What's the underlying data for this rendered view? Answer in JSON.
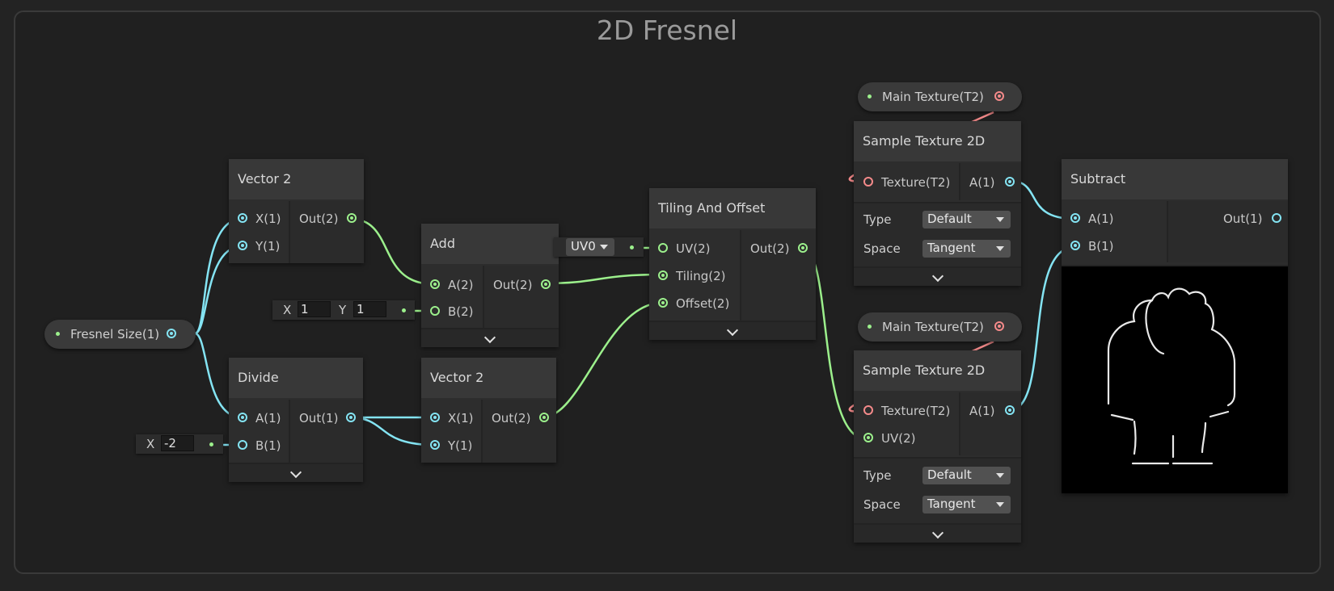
{
  "graph_title": "2D Fresnel",
  "colors": {
    "vector": "#84e4f3",
    "vector2": "#9cf08c",
    "texture": "#f48a8a"
  },
  "properties": {
    "fresnel_size": "Fresnel Size(1)",
    "main_texture_1": "Main Texture(T2)",
    "main_texture_2": "Main Texture(T2)"
  },
  "nodes": {
    "vector2_top": {
      "title": "Vector 2",
      "in_x": "X(1)",
      "in_y": "Y(1)",
      "out": "Out(2)"
    },
    "add": {
      "title": "Add",
      "in_a": "A(2)",
      "in_b": "B(2)",
      "out": "Out(2)",
      "b_field": {
        "x_label": "X",
        "x_value": "1",
        "y_label": "Y",
        "y_value": "1"
      }
    },
    "divide": {
      "title": "Divide",
      "in_a": "A(1)",
      "in_b": "B(1)",
      "out": "Out(1)",
      "b_field": {
        "x_label": "X",
        "x_value": "-2"
      }
    },
    "vector2_bottom": {
      "title": "Vector 2",
      "in_x": "X(1)",
      "in_y": "Y(1)",
      "out": "Out(2)"
    },
    "tiling": {
      "title": "Tiling And Offset",
      "in_uv": "UV(2)",
      "in_tiling": "Tiling(2)",
      "in_offset": "Offset(2)",
      "out": "Out(2)",
      "uv_dropdown": "UV0"
    },
    "sample1": {
      "title": "Sample Texture 2D",
      "in_tex": "Texture(T2)",
      "out": "A(1)",
      "type_label": "Type",
      "type_value": "Default",
      "space_label": "Space",
      "space_value": "Tangent"
    },
    "sample2": {
      "title": "Sample Texture 2D",
      "in_tex": "Texture(T2)",
      "in_uv": "UV(2)",
      "out": "A(1)",
      "type_label": "Type",
      "type_value": "Default",
      "space_label": "Space",
      "space_value": "Tangent"
    },
    "subtract": {
      "title": "Subtract",
      "in_a": "A(1)",
      "in_b": "B(1)",
      "out": "Out(1)"
    }
  }
}
